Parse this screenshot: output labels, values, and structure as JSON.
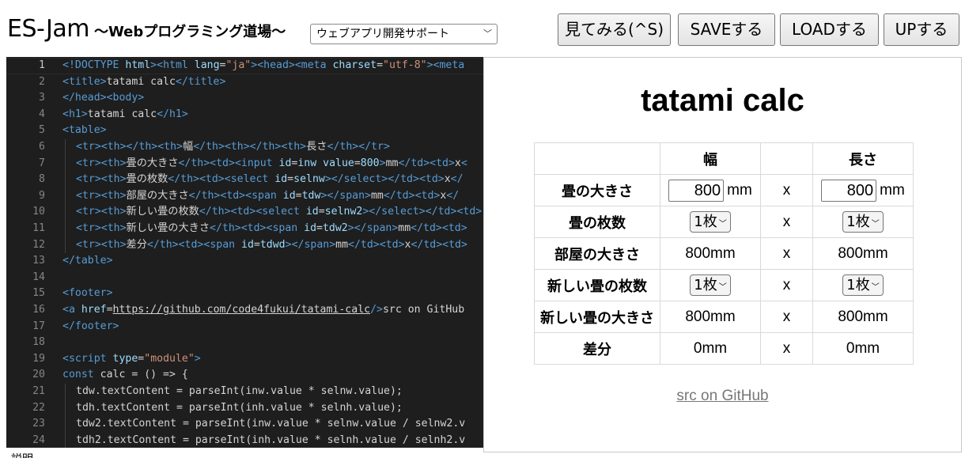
{
  "header": {
    "title": "ES-Jam",
    "subtitle": "〜Webプログラミング道場〜",
    "mode_select": {
      "selected": "ウェブアプリ開発サポート"
    },
    "buttons": {
      "view": "見てみる(^S)",
      "save": "SAVEする",
      "load": "LOADする",
      "up": "UPする"
    }
  },
  "editor": {
    "active_line": 1,
    "lines": [
      {
        "n": "1",
        "indent": 0,
        "tokens": [
          [
            "tag",
            "<!DOCTYPE "
          ],
          [
            "att",
            "html"
          ],
          [
            "tag",
            ">"
          ],
          [
            "tag",
            "<html "
          ],
          [
            "att",
            "lang"
          ],
          [
            "txt",
            "="
          ],
          [
            "str",
            "\"ja\""
          ],
          [
            "tag",
            ">"
          ],
          [
            "tag",
            "<head>"
          ],
          [
            "tag",
            "<meta "
          ],
          [
            "att",
            "charset"
          ],
          [
            "txt",
            "="
          ],
          [
            "str",
            "\"utf-8\""
          ],
          [
            "tag",
            ">"
          ],
          [
            "tag",
            "<meta"
          ]
        ]
      },
      {
        "n": "2",
        "indent": 0,
        "tokens": [
          [
            "tag",
            "<title>"
          ],
          [
            "txt",
            "tatami calc"
          ],
          [
            "tag",
            "</title>"
          ]
        ]
      },
      {
        "n": "3",
        "indent": 0,
        "tokens": [
          [
            "tag",
            "</head>"
          ],
          [
            "tag",
            "<body>"
          ]
        ]
      },
      {
        "n": "4",
        "indent": 0,
        "tokens": [
          [
            "tag",
            "<h1>"
          ],
          [
            "txt",
            "tatami calc"
          ],
          [
            "tag",
            "</h1>"
          ]
        ]
      },
      {
        "n": "5",
        "indent": 0,
        "tokens": [
          [
            "tag",
            "<table>"
          ]
        ]
      },
      {
        "n": "6",
        "indent": 1,
        "tokens": [
          [
            "tag",
            "<tr>"
          ],
          [
            "tag",
            "<th>"
          ],
          [
            "tag",
            "</th>"
          ],
          [
            "tag",
            "<th>"
          ],
          [
            "txt",
            "幅"
          ],
          [
            "tag",
            "</th>"
          ],
          [
            "tag",
            "<th>"
          ],
          [
            "tag",
            "</th>"
          ],
          [
            "tag",
            "<th>"
          ],
          [
            "txt",
            "長さ"
          ],
          [
            "tag",
            "</th>"
          ],
          [
            "tag",
            "</tr>"
          ]
        ]
      },
      {
        "n": "7",
        "indent": 1,
        "tokens": [
          [
            "tag",
            "<tr>"
          ],
          [
            "tag",
            "<th>"
          ],
          [
            "txt",
            "畳の大きさ"
          ],
          [
            "tag",
            "</th>"
          ],
          [
            "tag",
            "<td>"
          ],
          [
            "tag",
            "<input "
          ],
          [
            "att",
            "id"
          ],
          [
            "txt",
            "="
          ],
          [
            "att",
            "inw "
          ],
          [
            "att",
            "value"
          ],
          [
            "txt",
            "="
          ],
          [
            "att",
            "800"
          ],
          [
            "tag",
            ">"
          ],
          [
            "txt",
            "mm"
          ],
          [
            "tag",
            "</td>"
          ],
          [
            "tag",
            "<td>"
          ],
          [
            "txt",
            "x"
          ],
          [
            "tag",
            "<"
          ]
        ]
      },
      {
        "n": "8",
        "indent": 1,
        "tokens": [
          [
            "tag",
            "<tr>"
          ],
          [
            "tag",
            "<th>"
          ],
          [
            "txt",
            "畳の枚数"
          ],
          [
            "tag",
            "</th>"
          ],
          [
            "tag",
            "<td>"
          ],
          [
            "tag",
            "<select "
          ],
          [
            "att",
            "id"
          ],
          [
            "txt",
            "="
          ],
          [
            "att",
            "selnw"
          ],
          [
            "tag",
            "></select>"
          ],
          [
            "tag",
            "</td>"
          ],
          [
            "tag",
            "<td>"
          ],
          [
            "txt",
            "x"
          ],
          [
            "tag",
            "</"
          ]
        ]
      },
      {
        "n": "9",
        "indent": 1,
        "tokens": [
          [
            "tag",
            "<tr>"
          ],
          [
            "tag",
            "<th>"
          ],
          [
            "txt",
            "部屋の大きさ"
          ],
          [
            "tag",
            "</th>"
          ],
          [
            "tag",
            "<td>"
          ],
          [
            "tag",
            "<span "
          ],
          [
            "att",
            "id"
          ],
          [
            "txt",
            "="
          ],
          [
            "att",
            "tdw"
          ],
          [
            "tag",
            "></span>"
          ],
          [
            "txt",
            "mm"
          ],
          [
            "tag",
            "</td>"
          ],
          [
            "tag",
            "<td>"
          ],
          [
            "txt",
            "x"
          ],
          [
            "tag",
            "</"
          ]
        ]
      },
      {
        "n": "10",
        "indent": 1,
        "tokens": [
          [
            "tag",
            "<tr>"
          ],
          [
            "tag",
            "<th>"
          ],
          [
            "txt",
            "新しい畳の枚数"
          ],
          [
            "tag",
            "</th>"
          ],
          [
            "tag",
            "<td>"
          ],
          [
            "tag",
            "<select "
          ],
          [
            "att",
            "id"
          ],
          [
            "txt",
            "="
          ],
          [
            "att",
            "selnw2"
          ],
          [
            "tag",
            "></select>"
          ],
          [
            "tag",
            "</td>"
          ],
          [
            "tag",
            "<td>"
          ]
        ]
      },
      {
        "n": "11",
        "indent": 1,
        "tokens": [
          [
            "tag",
            "<tr>"
          ],
          [
            "tag",
            "<th>"
          ],
          [
            "txt",
            "新しい畳の大きさ"
          ],
          [
            "tag",
            "</th>"
          ],
          [
            "tag",
            "<td>"
          ],
          [
            "tag",
            "<span "
          ],
          [
            "att",
            "id"
          ],
          [
            "txt",
            "="
          ],
          [
            "att",
            "tdw2"
          ],
          [
            "tag",
            "></span>"
          ],
          [
            "txt",
            "mm"
          ],
          [
            "tag",
            "</td>"
          ],
          [
            "tag",
            "<td>"
          ]
        ]
      },
      {
        "n": "12",
        "indent": 1,
        "tokens": [
          [
            "tag",
            "<tr>"
          ],
          [
            "tag",
            "<th>"
          ],
          [
            "txt",
            "差分"
          ],
          [
            "tag",
            "</th>"
          ],
          [
            "tag",
            "<td>"
          ],
          [
            "tag",
            "<span "
          ],
          [
            "att",
            "id"
          ],
          [
            "txt",
            "="
          ],
          [
            "att",
            "tdwd"
          ],
          [
            "tag",
            "></span>"
          ],
          [
            "txt",
            "mm"
          ],
          [
            "tag",
            "</td>"
          ],
          [
            "tag",
            "<td>"
          ],
          [
            "txt",
            "x"
          ],
          [
            "tag",
            "</td>"
          ],
          [
            "tag",
            "<td>"
          ]
        ]
      },
      {
        "n": "13",
        "indent": 0,
        "tokens": [
          [
            "tag",
            "</table>"
          ]
        ]
      },
      {
        "n": "14",
        "indent": 0,
        "tokens": []
      },
      {
        "n": "15",
        "indent": 0,
        "tokens": [
          [
            "tag",
            "<footer>"
          ]
        ]
      },
      {
        "n": "16",
        "indent": 0,
        "tokens": [
          [
            "tag",
            "<a "
          ],
          [
            "att",
            "href"
          ],
          [
            "txt",
            "="
          ],
          [
            "url",
            "https://github.com/code4fukui/tatami-calc"
          ],
          [
            "tag",
            "/>"
          ],
          [
            "txt",
            "src on GitHub"
          ]
        ]
      },
      {
        "n": "17",
        "indent": 0,
        "tokens": [
          [
            "tag",
            "</footer>"
          ]
        ]
      },
      {
        "n": "18",
        "indent": 0,
        "tokens": []
      },
      {
        "n": "19",
        "indent": 0,
        "tokens": [
          [
            "tag",
            "<script "
          ],
          [
            "att",
            "type"
          ],
          [
            "txt",
            "="
          ],
          [
            "str",
            "\"module\""
          ],
          [
            "tag",
            ">"
          ]
        ]
      },
      {
        "n": "20",
        "indent": 0,
        "tokens": [
          [
            "kw",
            "const "
          ],
          [
            "txt",
            "calc = () => {"
          ]
        ]
      },
      {
        "n": "21",
        "indent": 1,
        "tokens": [
          [
            "txt",
            "tdw.textContent = parseInt(inw.value * selnw.value);"
          ]
        ]
      },
      {
        "n": "22",
        "indent": 1,
        "tokens": [
          [
            "txt",
            "tdh.textContent = parseInt(inh.value * selnh.value);"
          ]
        ]
      },
      {
        "n": "23",
        "indent": 1,
        "tokens": [
          [
            "txt",
            "tdw2.textContent = parseInt(inw.value * selnw.value / selnw2.v"
          ]
        ]
      },
      {
        "n": "24",
        "indent": 1,
        "tokens": [
          [
            "txt",
            "tdh2.textContent = parseInt(inh.value * selnh.value / selnh2.v"
          ]
        ]
      }
    ]
  },
  "preview": {
    "heading": "tatami calc",
    "table": {
      "head": [
        "",
        "幅",
        "",
        "長さ"
      ],
      "rows": [
        {
          "label": "畳の大きさ",
          "kind": "input",
          "w": "800",
          "h": "800",
          "unit": "mm",
          "x": "x"
        },
        {
          "label": "畳の枚数",
          "kind": "select",
          "w": "1枚",
          "h": "1枚",
          "x": "x"
        },
        {
          "label": "部屋の大きさ",
          "kind": "text",
          "w": "800mm",
          "h": "800mm",
          "x": "x"
        },
        {
          "label": "新しい畳の枚数",
          "kind": "select",
          "w": "1枚",
          "h": "1枚",
          "x": "x"
        },
        {
          "label": "新しい畳の大きさ",
          "kind": "text",
          "w": "800mm",
          "h": "800mm",
          "x": "x"
        },
        {
          "label": "差分",
          "kind": "text",
          "w": "0mm",
          "h": "0mm",
          "x": "x"
        }
      ]
    },
    "footer_link": "src on GitHub"
  },
  "bottom_hint": "説明"
}
